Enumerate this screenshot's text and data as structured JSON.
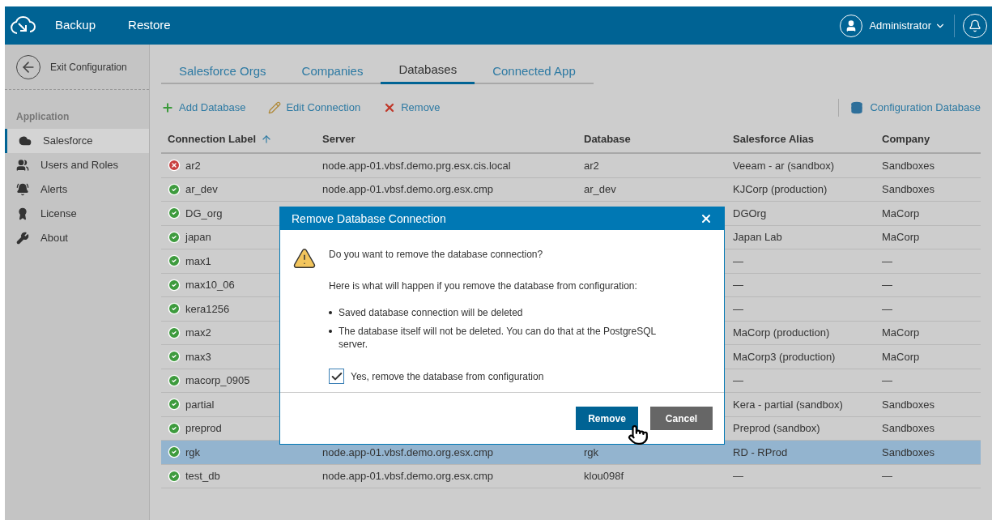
{
  "topbar": {
    "nav": [
      {
        "label": "Backup"
      },
      {
        "label": "Restore"
      }
    ],
    "user": "Administrator"
  },
  "sidebar": {
    "exit": "Exit Configuration",
    "section": "Application",
    "items": [
      {
        "label": "Salesforce",
        "selected": true
      },
      {
        "label": "Users and Roles",
        "selected": false
      },
      {
        "label": "Alerts",
        "selected": false
      },
      {
        "label": "License",
        "selected": false
      },
      {
        "label": "About",
        "selected": false
      }
    ]
  },
  "tabs": [
    {
      "label": "Salesforce Orgs",
      "selected": false
    },
    {
      "label": "Companies",
      "selected": false
    },
    {
      "label": "Databases",
      "selected": true
    },
    {
      "label": "Connected App",
      "selected": false
    }
  ],
  "toolbar": {
    "actions": [
      {
        "label": "Add Database",
        "kind": "add"
      },
      {
        "label": "Edit Connection",
        "kind": "edit"
      },
      {
        "label": "Remove",
        "kind": "remove"
      }
    ],
    "config": "Configuration Database"
  },
  "table": {
    "columns": [
      {
        "label": "Connection Label",
        "sorted": true
      },
      {
        "label": "Server",
        "sorted": false
      },
      {
        "label": "Database",
        "sorted": false
      },
      {
        "label": "Salesforce Alias",
        "sorted": false
      },
      {
        "label": "Company",
        "sorted": false
      }
    ],
    "rows": [
      {
        "kind": "error",
        "label": "ar2",
        "server": "node.app-01.vbsf.demo.prg.esx.cis.local",
        "database": "ar2",
        "alias": "Veeam - ar (sandbox)",
        "company": "Sandboxes",
        "selected": false
      },
      {
        "kind": "ok",
        "label": "ar_dev",
        "server": "node.app-01.vbsf.demo.org.esx.cmp",
        "database": "ar_dev",
        "alias": "KJCorp (production)",
        "company": "Sandboxes",
        "selected": false
      },
      {
        "kind": "ok",
        "label": "DG_org",
        "alias": "DGOrg",
        "company": "MaCorp",
        "selected": false
      },
      {
        "kind": "ok",
        "label": "japan",
        "alias": "Japan Lab",
        "company": "MaCorp",
        "selected": false
      },
      {
        "kind": "ok",
        "label": "max1",
        "alias": "—",
        "company": "—",
        "selected": false
      },
      {
        "kind": "ok",
        "label": "max10_06",
        "alias": "—",
        "company": "—",
        "selected": false
      },
      {
        "kind": "ok",
        "label": "kera1256",
        "alias": "—",
        "company": "—",
        "selected": false
      },
      {
        "kind": "ok",
        "label": "max2",
        "alias": "MaCorp (production)",
        "company": "MaCorp",
        "selected": false
      },
      {
        "kind": "ok",
        "label": "max3",
        "alias": "MaCorp3 (production)",
        "company": "MaCorp",
        "selected": false
      },
      {
        "kind": "ok",
        "label": "macorp_0905",
        "alias": "—",
        "company": "—",
        "selected": false
      },
      {
        "kind": "ok",
        "label": "partial",
        "alias": "Kera - partial (sandbox)",
        "company": "Sandboxes",
        "selected": false
      },
      {
        "kind": "ok",
        "label": "preprod",
        "alias": "Preprod (sandbox)",
        "company": "Sandboxes",
        "selected": false
      },
      {
        "kind": "ok",
        "label": "rgk",
        "server": "node.app-01.vbsf.demo.org.esx.cmp",
        "database": "rgk",
        "alias": "RD - RProd",
        "company": "Sandboxes",
        "selected": true
      },
      {
        "kind": "ok",
        "label": "test_db",
        "server": "node.app-01.vbsf.demo.org.esx.cmp",
        "database": "klou098f",
        "alias": "—",
        "company": "—",
        "selected": false
      }
    ]
  },
  "dialog": {
    "title": "Remove Database Connection",
    "question": "Do you want to remove the database connection?",
    "intro": "Here is what will happen if you remove the database from configuration:",
    "bullets": [
      "Saved database connection will be deleted",
      "The database itself will not be deleted. You can do that at the PostgreSQL server."
    ],
    "confirm": {
      "label": "Yes, remove the database from configuration",
      "checked": true
    },
    "buttons": [
      {
        "label": "Remove",
        "kind": "primary"
      },
      {
        "label": "Cancel",
        "kind": "secondary"
      }
    ]
  }
}
